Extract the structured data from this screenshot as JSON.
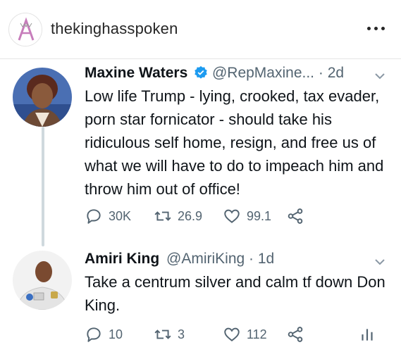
{
  "post": {
    "username": "thekinghasspoken"
  },
  "tweets": [
    {
      "name": "Maxine Waters",
      "verified": true,
      "handle": "@RepMaxine...",
      "time": "2d",
      "text": "Low life Trump - lying, crooked, tax evader, porn star fornicator - should take his ridiculous self home, resign, and free us of what we will have to do to impeach him and throw him out of office!",
      "replies": "30K",
      "retweets": "26.9",
      "likes": "99.1"
    },
    {
      "name": "Amiri King",
      "verified": false,
      "handle": "@AmiriKing",
      "time": "1d",
      "text": "Take a centrum silver and calm tf down Don King.",
      "replies": "10",
      "retweets": "3",
      "likes": "112"
    }
  ],
  "colors": {
    "verified": "#1d9bf0",
    "secondary_text": "#536471",
    "thread_line": "#cfd9de"
  }
}
